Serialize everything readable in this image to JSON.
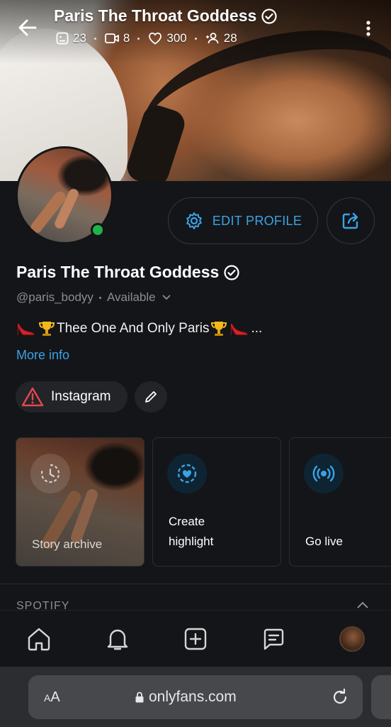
{
  "header": {
    "title": "Paris The Throat Goddess",
    "stats": [
      {
        "icon": "posts-icon",
        "value": "23"
      },
      {
        "icon": "video-icon",
        "value": "8"
      },
      {
        "icon": "heart-icon",
        "value": "300"
      },
      {
        "icon": "fans-icon",
        "value": "28"
      }
    ]
  },
  "profile": {
    "edit_label": "EDIT PROFILE",
    "name": "Paris The Throat Goddess",
    "handle": "@paris_bodyy",
    "status": "Available",
    "bio_text": "Thee One And Only Paris",
    "bio_more": "...",
    "more_info": "More info",
    "links": [
      {
        "label": "Instagram"
      }
    ]
  },
  "highlights": {
    "archive": "Story archive",
    "create_line1": "Create",
    "create_line2": "highlight",
    "live": "Go live"
  },
  "sections": {
    "spotify": "SPOTIFY"
  },
  "nav": [
    "home-icon",
    "bell-icon",
    "add-post-icon",
    "messages-icon",
    "profile-avatar"
  ],
  "browser": {
    "aa_small": "A",
    "aa_big": "A",
    "url": "onlyfans.com"
  },
  "colors": {
    "accent": "#3aa3e6",
    "online": "#1fb34a",
    "background": "#141518"
  }
}
